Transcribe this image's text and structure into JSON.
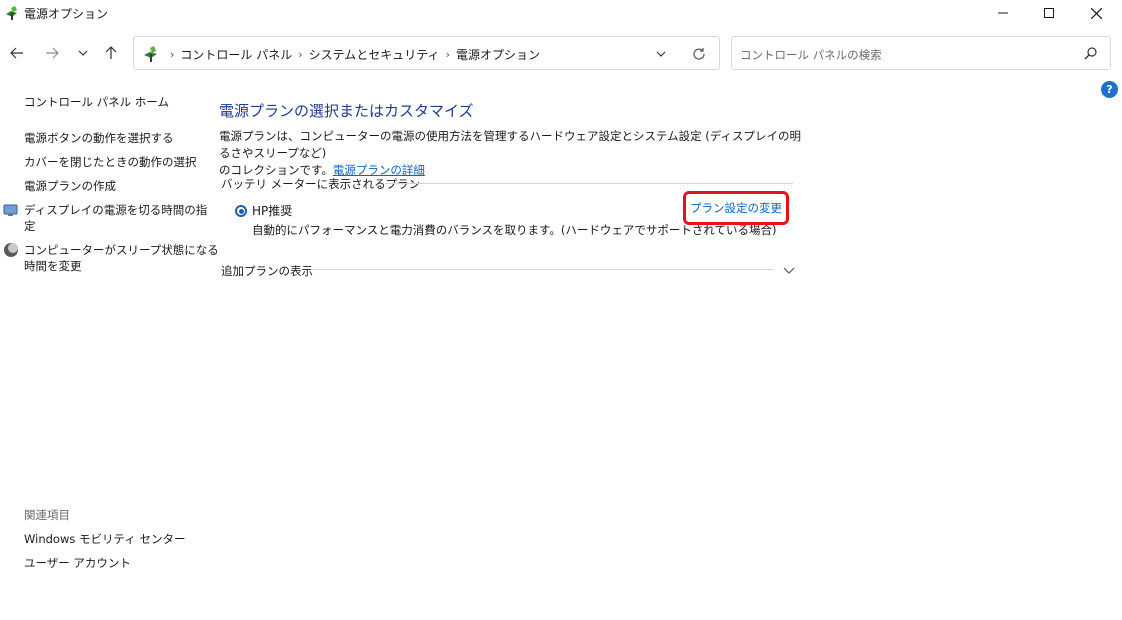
{
  "window": {
    "title": "電源オプション"
  },
  "address": {
    "breadcrumbs": [
      "コントロール パネル",
      "システムとセキュリティ",
      "電源オプション"
    ]
  },
  "search": {
    "placeholder": "コントロール パネルの検索"
  },
  "sidebar": {
    "home": "コントロール パネル ホーム",
    "items": [
      {
        "label": "電源ボタンの動作を選択する"
      },
      {
        "label": "カバーを閉じたときの動作の選択"
      },
      {
        "label": "電源プランの作成"
      },
      {
        "label_line1": "ディスプレイの電源を切る時間の指",
        "label_line2": "定",
        "icon": "display-icon"
      },
      {
        "label_line1": "コンピューターがスリープ状態になる",
        "label_line2": "時間を変更",
        "icon": "moon-icon"
      }
    ],
    "related_heading": "関連項目",
    "related": [
      {
        "label": "Windows モビリティ センター"
      },
      {
        "label": "ユーザー アカウント"
      }
    ]
  },
  "main": {
    "title": "電源プランの選択またはカスタマイズ",
    "desc_line1": "電源プランは、コンピューターの電源の使用方法を管理するハードウェア設定とシステム設定 (ディスプレイの明るさやスリープなど)",
    "desc_line2_prefix": "のコレクションです。",
    "desc_link": "電源プランの詳細",
    "section_label": "バッテリ メーターに表示されるプラン",
    "plan": {
      "name": "HP推奨",
      "selected": true,
      "description": "自動的にパフォーマンスと電力消費のバランスを取ります。(ハードウェアでサポートされている場合)",
      "change_link": "プラン設定の変更"
    },
    "more_plans": "追加プランの表示"
  },
  "colors": {
    "accent": "#1f5bb0",
    "link": "#0b63c5",
    "title": "#1e3c8c",
    "highlight_box": "#e3131e"
  }
}
